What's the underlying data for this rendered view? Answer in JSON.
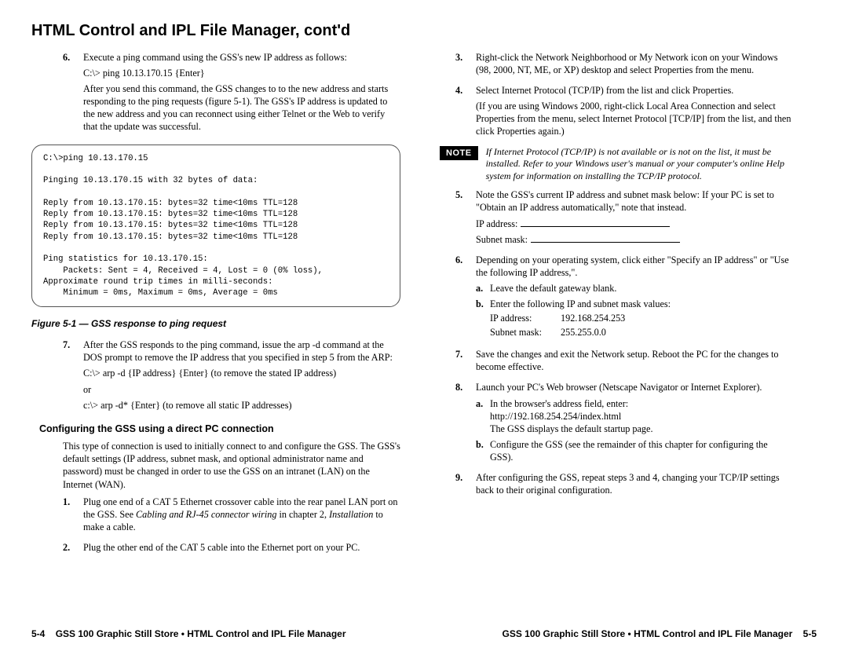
{
  "title": "HTML Control and IPL File Manager, cont'd",
  "left": {
    "step6": {
      "num": "6.",
      "p1": "Execute a ping command using the GSS's new IP address as follows:",
      "p2": "C:\\> ping 10.13.170.15 {Enter}",
      "p3": "After you send this command, the GSS changes to to the new address and starts responding to the ping requests (figure 5-1).  The GSS's IP address is updated to the new address and you can reconnect using either Telnet or the Web to verify that the update was successful."
    },
    "ping_block": "C:\\>ping 10.13.170.15\n\nPinging 10.13.170.15 with 32 bytes of data:\n\nReply from 10.13.170.15: bytes=32 time<10ms TTL=128\nReply from 10.13.170.15: bytes=32 time<10ms TTL=128\nReply from 10.13.170.15: bytes=32 time<10ms TTL=128\nReply from 10.13.170.15: bytes=32 time<10ms TTL=128\n\nPing statistics for 10.13.170.15:\n    Packets: Sent = 4, Received = 4, Lost = 0 (0% loss),\nApproximate round trip times in milli-seconds:\n    Minimum = 0ms, Maximum = 0ms, Average = 0ms",
    "figcap": "Figure 5-1 — GSS response to ping request",
    "step7": {
      "num": "7.",
      "p1": "After the GSS responds to the ping command, issue the arp -d command at the DOS prompt to remove the IP address that you specified in step 5 from the ARP:",
      "p2": "C:\\> arp -d {IP address} {Enter} (to remove the stated IP address)",
      "p3": "or",
      "p4": "c:\\> arp -d* {Enter} (to remove all static IP addresses)"
    },
    "h3": "Configuring the GSS using a direct PC connection",
    "intro": "This type of connection is used to initially connect to and configure the GSS.  The GSS's default settings (IP address, subnet mask, and optional administrator name and password) must be changed in order to use the GSS on an intranet (LAN) on the Internet (WAN).",
    "s1": {
      "num": "1.",
      "p1a": "Plug one end of a CAT 5 Ethernet crossover cable into the rear panel LAN port on the GSS.  See ",
      "p1b": "Cabling and RJ-45 connector wiring",
      "p1c": " in chapter 2, ",
      "p1d": "Installation",
      "p1e": " to make a cable."
    },
    "s2": {
      "num": "2.",
      "p": "Plug the other end of the CAT 5 cable into the Ethernet port on your PC."
    }
  },
  "right": {
    "s3": {
      "num": "3.",
      "p": "Right-click the Network Neighborhood or My Network icon on your Windows (98, 2000, NT, ME, or XP) desktop and select Properties from the menu."
    },
    "s4": {
      "num": "4.",
      "p1": "Select Internet Protocol (TCP/IP) from the list and click Properties.",
      "p2": "(If you are using Windows 2000, right-click Local Area Connection and select Properties from the menu, select Internet Protocol [TCP/IP] from the list, and then click Properties again.)"
    },
    "note_label": "NOTE",
    "note_text": "If Internet Protocol (TCP/IP) is not available or is not on the list, it must be installed.  Refer to your Windows user's manual or your computer's online Help system for information on installing the TCP/IP protocol.",
    "s5": {
      "num": "5.",
      "p1": "Note the GSS's current IP address and subnet mask below:  If your PC is set to \"Obtain an IP address automatically,\" note that instead.",
      "ip_label": "IP address:",
      "sm_label": "Subnet mask:"
    },
    "s6": {
      "num": "6.",
      "p": "Depending on your operating system, click either \"Specify an IP address\" or \"Use the following IP address,\".",
      "a": {
        "let": "a.",
        "t": "Leave the default gateway blank."
      },
      "b": {
        "let": "b.",
        "t": "Enter the following IP and subnet mask values:",
        "ip_k": "IP address:",
        "ip_v": "192.168.254.253",
        "sm_k": "Subnet mask:",
        "sm_v": "255.255.0.0"
      }
    },
    "s7": {
      "num": "7.",
      "p": "Save the changes and exit the Network setup.  Reboot the PC for the changes to become effective."
    },
    "s8": {
      "num": "8.",
      "p": "Launch your PC's Web browser (Netscape Navigator or Internet Explorer).",
      "a": {
        "let": "a.",
        "t1": "In the browser's address field, enter:",
        "t2": "http://192.168.254.254/index.html",
        "t3": "The GSS displays the default startup page."
      },
      "b": {
        "let": "b.",
        "t": "Configure the GSS (see the remainder of this chapter for configuring the GSS)."
      }
    },
    "s9": {
      "num": "9.",
      "p": "After configuring the GSS, repeat steps 3 and 4, changing your TCP/IP settings back to their original configuration."
    }
  },
  "footer": {
    "left_pg": "5-4",
    "left_txt": "GSS 100 Graphic Still Store • HTML Control and IPL File Manager",
    "right_txt": "GSS 100 Graphic Still Store • HTML Control and IPL File Manager",
    "right_pg": "5-5"
  }
}
